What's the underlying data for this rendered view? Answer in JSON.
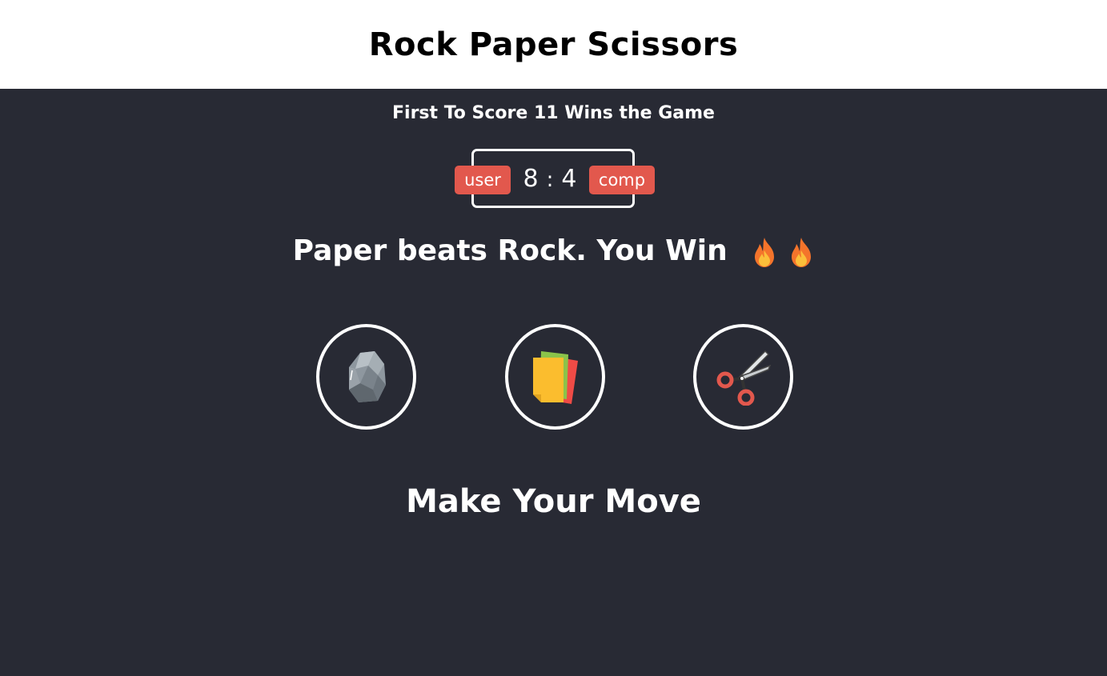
{
  "header": {
    "title": "Rock Paper Scissors"
  },
  "game": {
    "subtitle": "First To Score 11 Wins the Game",
    "scoreboard": {
      "user_label": "user",
      "comp_label": "comp",
      "user_score": "8",
      "separator": ":",
      "comp_score": "4"
    },
    "result_text": "Paper beats Rock. You Win",
    "result_icons": [
      "fire-icon",
      "fire-icon"
    ],
    "choices": [
      {
        "name": "rock",
        "icon": "rock-icon"
      },
      {
        "name": "paper",
        "icon": "paper-icon"
      },
      {
        "name": "scissors",
        "icon": "scissors-icon"
      }
    ],
    "prompt": "Make Your Move"
  },
  "colors": {
    "background": "#282a34",
    "header_background": "#ffffff",
    "badge": "#e2584d",
    "text": "#ffffff"
  }
}
